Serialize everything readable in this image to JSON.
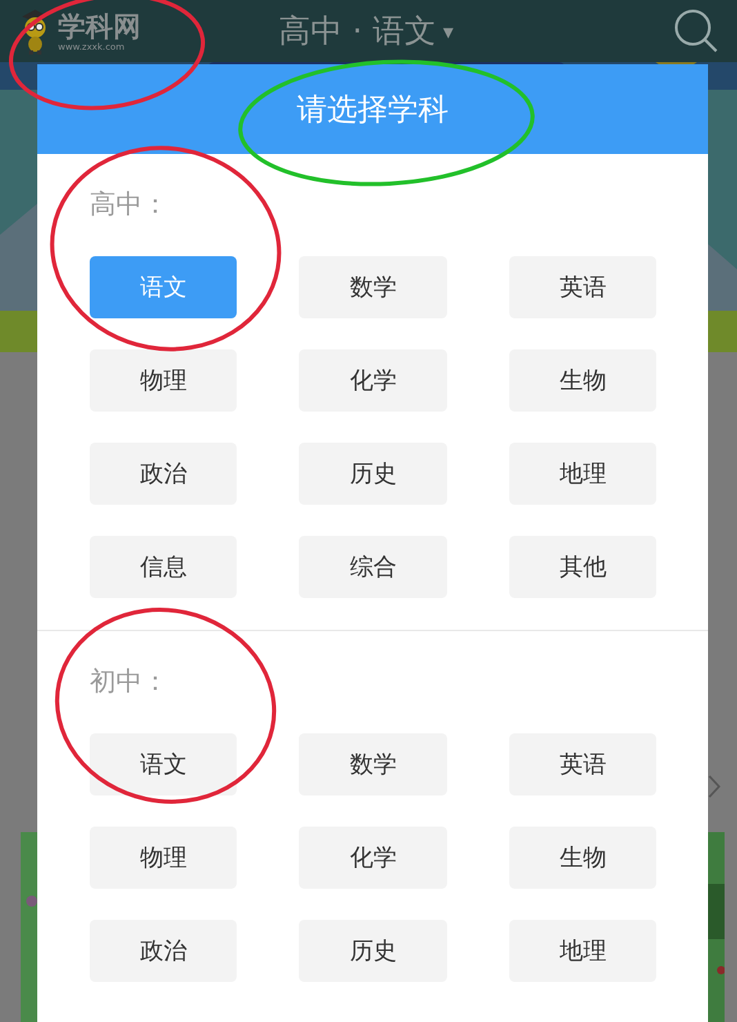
{
  "header": {
    "logo_text": "学科网",
    "logo_url": "www.zxxk.com",
    "title": "高中 · 语文",
    "caret": "▾"
  },
  "dialog": {
    "title": "请选择学科",
    "sections": [
      {
        "label": "高中：",
        "subjects": [
          {
            "name": "语文",
            "selected": true
          },
          {
            "name": "数学",
            "selected": false
          },
          {
            "name": "英语",
            "selected": false
          },
          {
            "name": "物理",
            "selected": false
          },
          {
            "name": "化学",
            "selected": false
          },
          {
            "name": "生物",
            "selected": false
          },
          {
            "name": "政治",
            "selected": false
          },
          {
            "name": "历史",
            "selected": false
          },
          {
            "name": "地理",
            "selected": false
          },
          {
            "name": "信息",
            "selected": false
          },
          {
            "name": "综合",
            "selected": false
          },
          {
            "name": "其他",
            "selected": false
          }
        ]
      },
      {
        "label": "初中：",
        "subjects": [
          {
            "name": "语文",
            "selected": false
          },
          {
            "name": "数学",
            "selected": false
          },
          {
            "name": "英语",
            "selected": false
          },
          {
            "name": "物理",
            "selected": false
          },
          {
            "name": "化学",
            "selected": false
          },
          {
            "name": "生物",
            "selected": false
          },
          {
            "name": "政治",
            "selected": false
          },
          {
            "name": "历史",
            "selected": false
          },
          {
            "name": "地理",
            "selected": false
          }
        ]
      }
    ]
  },
  "annotations": [
    {
      "color": "#e0263a"
    },
    {
      "color": "#22c02a"
    },
    {
      "color": "#e0263a"
    },
    {
      "color": "#e0263a"
    }
  ]
}
